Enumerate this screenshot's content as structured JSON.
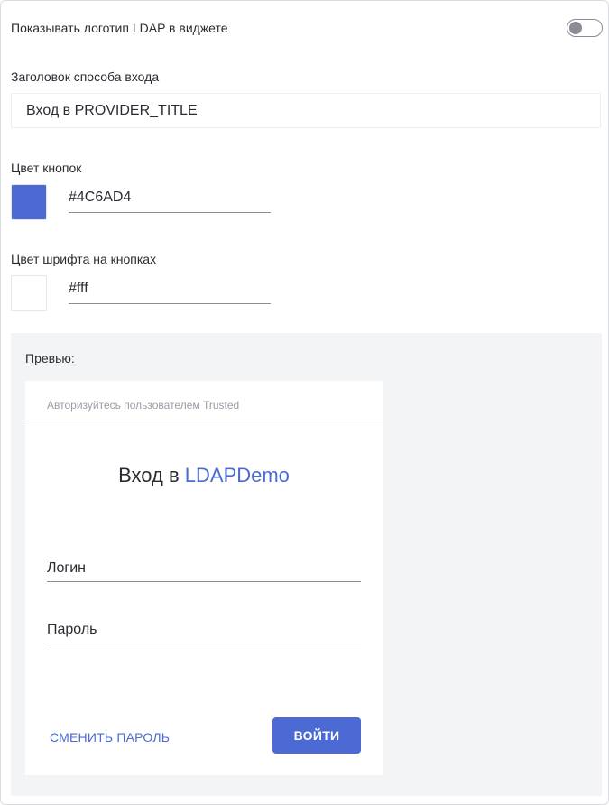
{
  "colors": {
    "accent": "#4C6AD4",
    "button_text": "#fff",
    "preview_bg": "#f3f4f6"
  },
  "logo_toggle": {
    "label": "Показывать логотип LDAP в виджете",
    "state": "off"
  },
  "login_title": {
    "label": "Заголовок способа входа",
    "value": "Вход в PROVIDER_TITLE"
  },
  "button_color": {
    "label": "Цвет кнопок",
    "value": "#4C6AD4"
  },
  "font_color": {
    "label": "Цвет шрифта на кнопках",
    "value": "#fff"
  },
  "preview": {
    "label": "Превью:",
    "hint": "Авторизуйтесь пользователем Trusted",
    "title_prefix": "Вход в",
    "provider": "LDAPDemo",
    "login_placeholder": "Логин",
    "password_placeholder": "Пароль",
    "change_password": "СМЕНИТЬ ПАРОЛЬ",
    "submit": "ВОЙТИ"
  }
}
